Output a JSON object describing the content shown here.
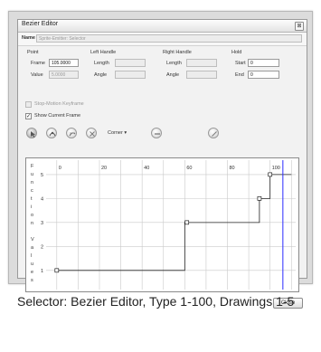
{
  "window": {
    "title": "Bezier Editor",
    "close_glyph": "⊠"
  },
  "name_row": {
    "label": "Name",
    "value": "Sprite-Emitter: Selector"
  },
  "point": {
    "heading": "Point",
    "frame_label": "Frame",
    "frame_value": "105.0000",
    "value_label": "Value",
    "value_value": "5.0000"
  },
  "left_handle": {
    "heading": "Left Handle",
    "length_label": "Length",
    "angle_label": "Angle"
  },
  "right_handle": {
    "heading": "Right Handle",
    "length_label": "Length",
    "angle_label": "Angle"
  },
  "hold": {
    "heading": "Hold",
    "start_label": "Start",
    "start_value": "0",
    "end_label": "End",
    "end_value": "0"
  },
  "options": {
    "stop_motion_label": "Stop-Motion Keyframe",
    "stop_motion_checked": false,
    "show_frame_label": "Show Current Frame",
    "show_frame_checked": true
  },
  "toolbar": {
    "corner_label": "Corner",
    "corner_arrow": "▾",
    "icons": [
      "select-point-icon",
      "add-point-icon",
      "smooth-icon",
      "delete-icon",
      "zoom-out-icon",
      "no-tool-icon"
    ]
  },
  "graph": {
    "y_axis_text": [
      "F",
      "u",
      "n",
      "c",
      "t",
      "i",
      "o",
      "n",
      "",
      "V",
      "a",
      "l",
      "u",
      "e",
      "s"
    ],
    "x_ticks": [
      "0",
      "20",
      "40",
      "60",
      "80",
      "100"
    ],
    "y_ticks": [
      "1",
      "2",
      "3",
      "4",
      "5"
    ],
    "current_frame": 106,
    "x_range": [
      -5,
      112
    ],
    "y_range": [
      0.2,
      5.6
    ],
    "points": [
      [
        0,
        1
      ],
      [
        60,
        1
      ],
      [
        60,
        3
      ],
      [
        95,
        3
      ],
      [
        95,
        4
      ],
      [
        100,
        4
      ],
      [
        100,
        5
      ],
      [
        110,
        5
      ]
    ],
    "keyframes": [
      [
        0,
        1
      ],
      [
        61,
        3
      ],
      [
        95,
        4
      ],
      [
        100,
        5
      ]
    ],
    "colors": {
      "curve": "#222222",
      "grid": "#c9c9c9",
      "frame_line": "#2c2cff"
    }
  },
  "close_button": {
    "label": "Close"
  },
  "caption": "Selector: Bezier Editor, Type 1-100, Drawings 1-5"
}
